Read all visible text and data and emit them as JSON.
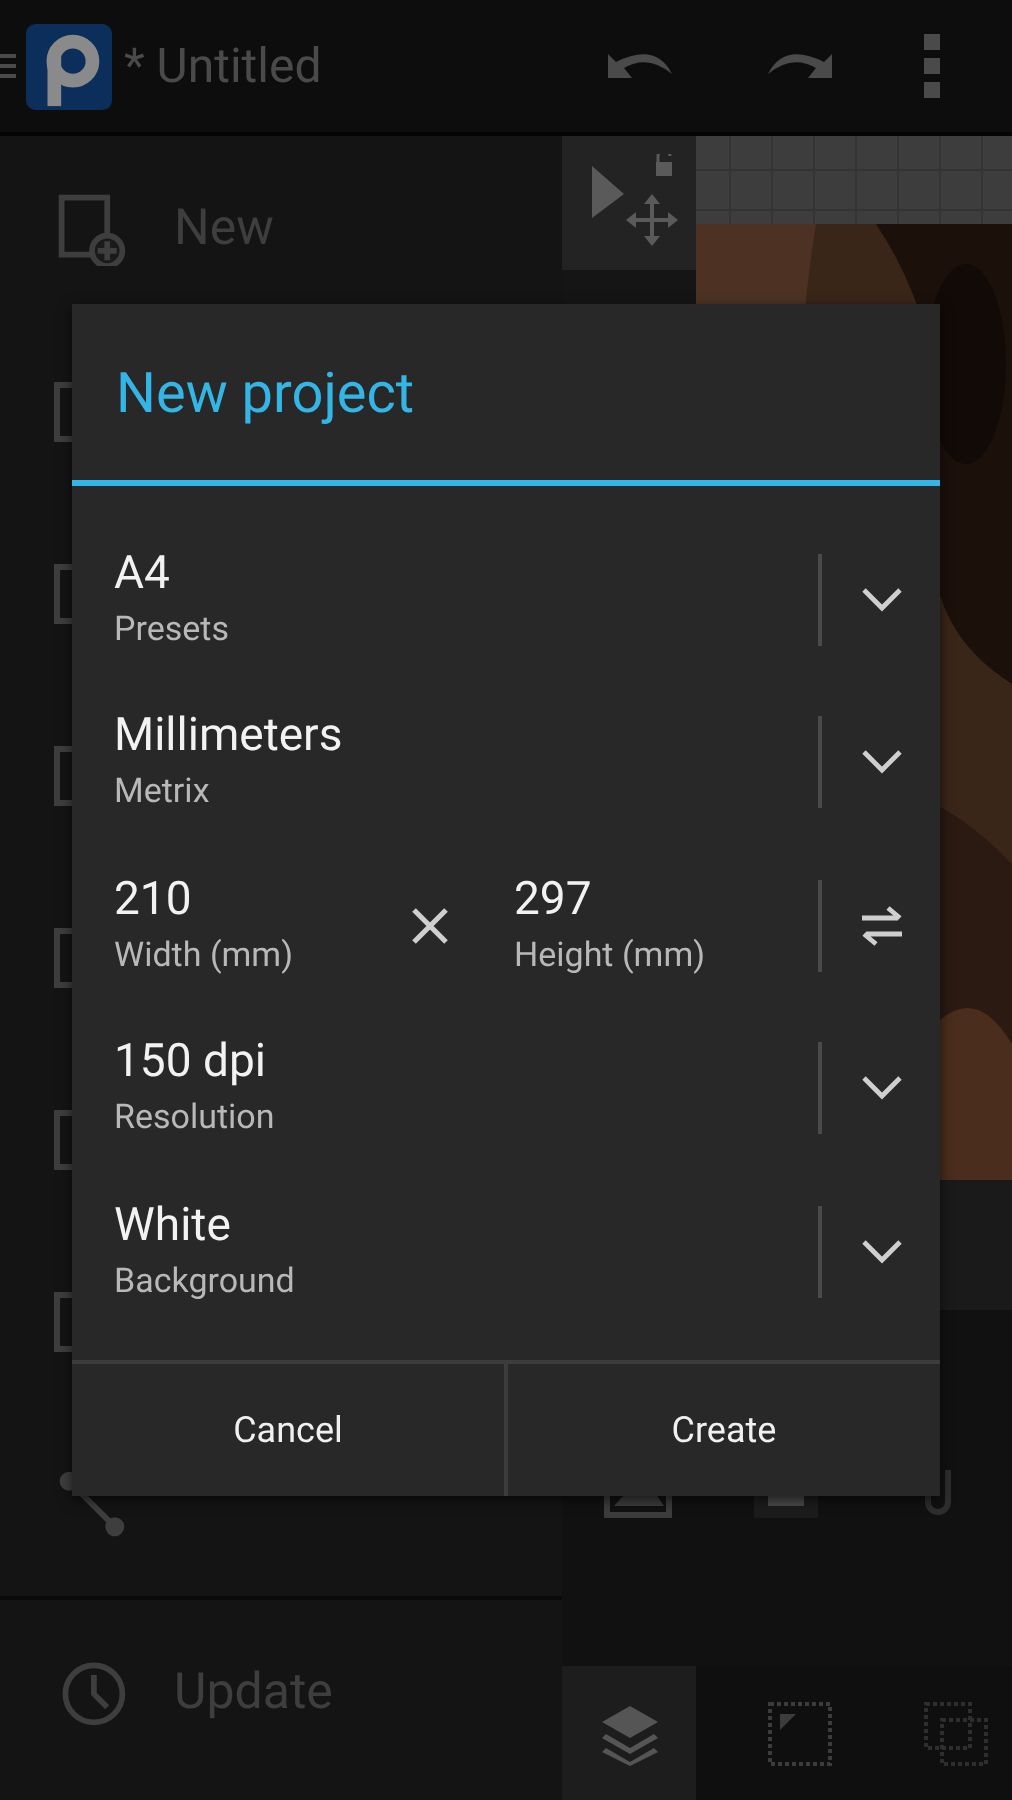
{
  "app_bar": {
    "title": "* Untitled"
  },
  "drawer": {
    "items": [
      {
        "label": "New",
        "kind": "new"
      },
      {
        "kind": "share"
      },
      {
        "label": "Update",
        "kind": "update"
      }
    ]
  },
  "dialog": {
    "title": "New project",
    "rows": [
      {
        "kind": "select",
        "value": "A4",
        "label": "Presets"
      },
      {
        "kind": "select",
        "value": "Millimeters",
        "label": "Metrix"
      },
      {
        "kind": "size",
        "value": "210",
        "label": "Width (mm)",
        "value_2": "297",
        "label_2": "Height (mm)"
      },
      {
        "kind": "select",
        "value": "150 dpi",
        "label": "Resolution"
      },
      {
        "kind": "select",
        "value": "White",
        "label": "Background"
      }
    ],
    "buttons": [
      "Cancel",
      "Create"
    ]
  }
}
